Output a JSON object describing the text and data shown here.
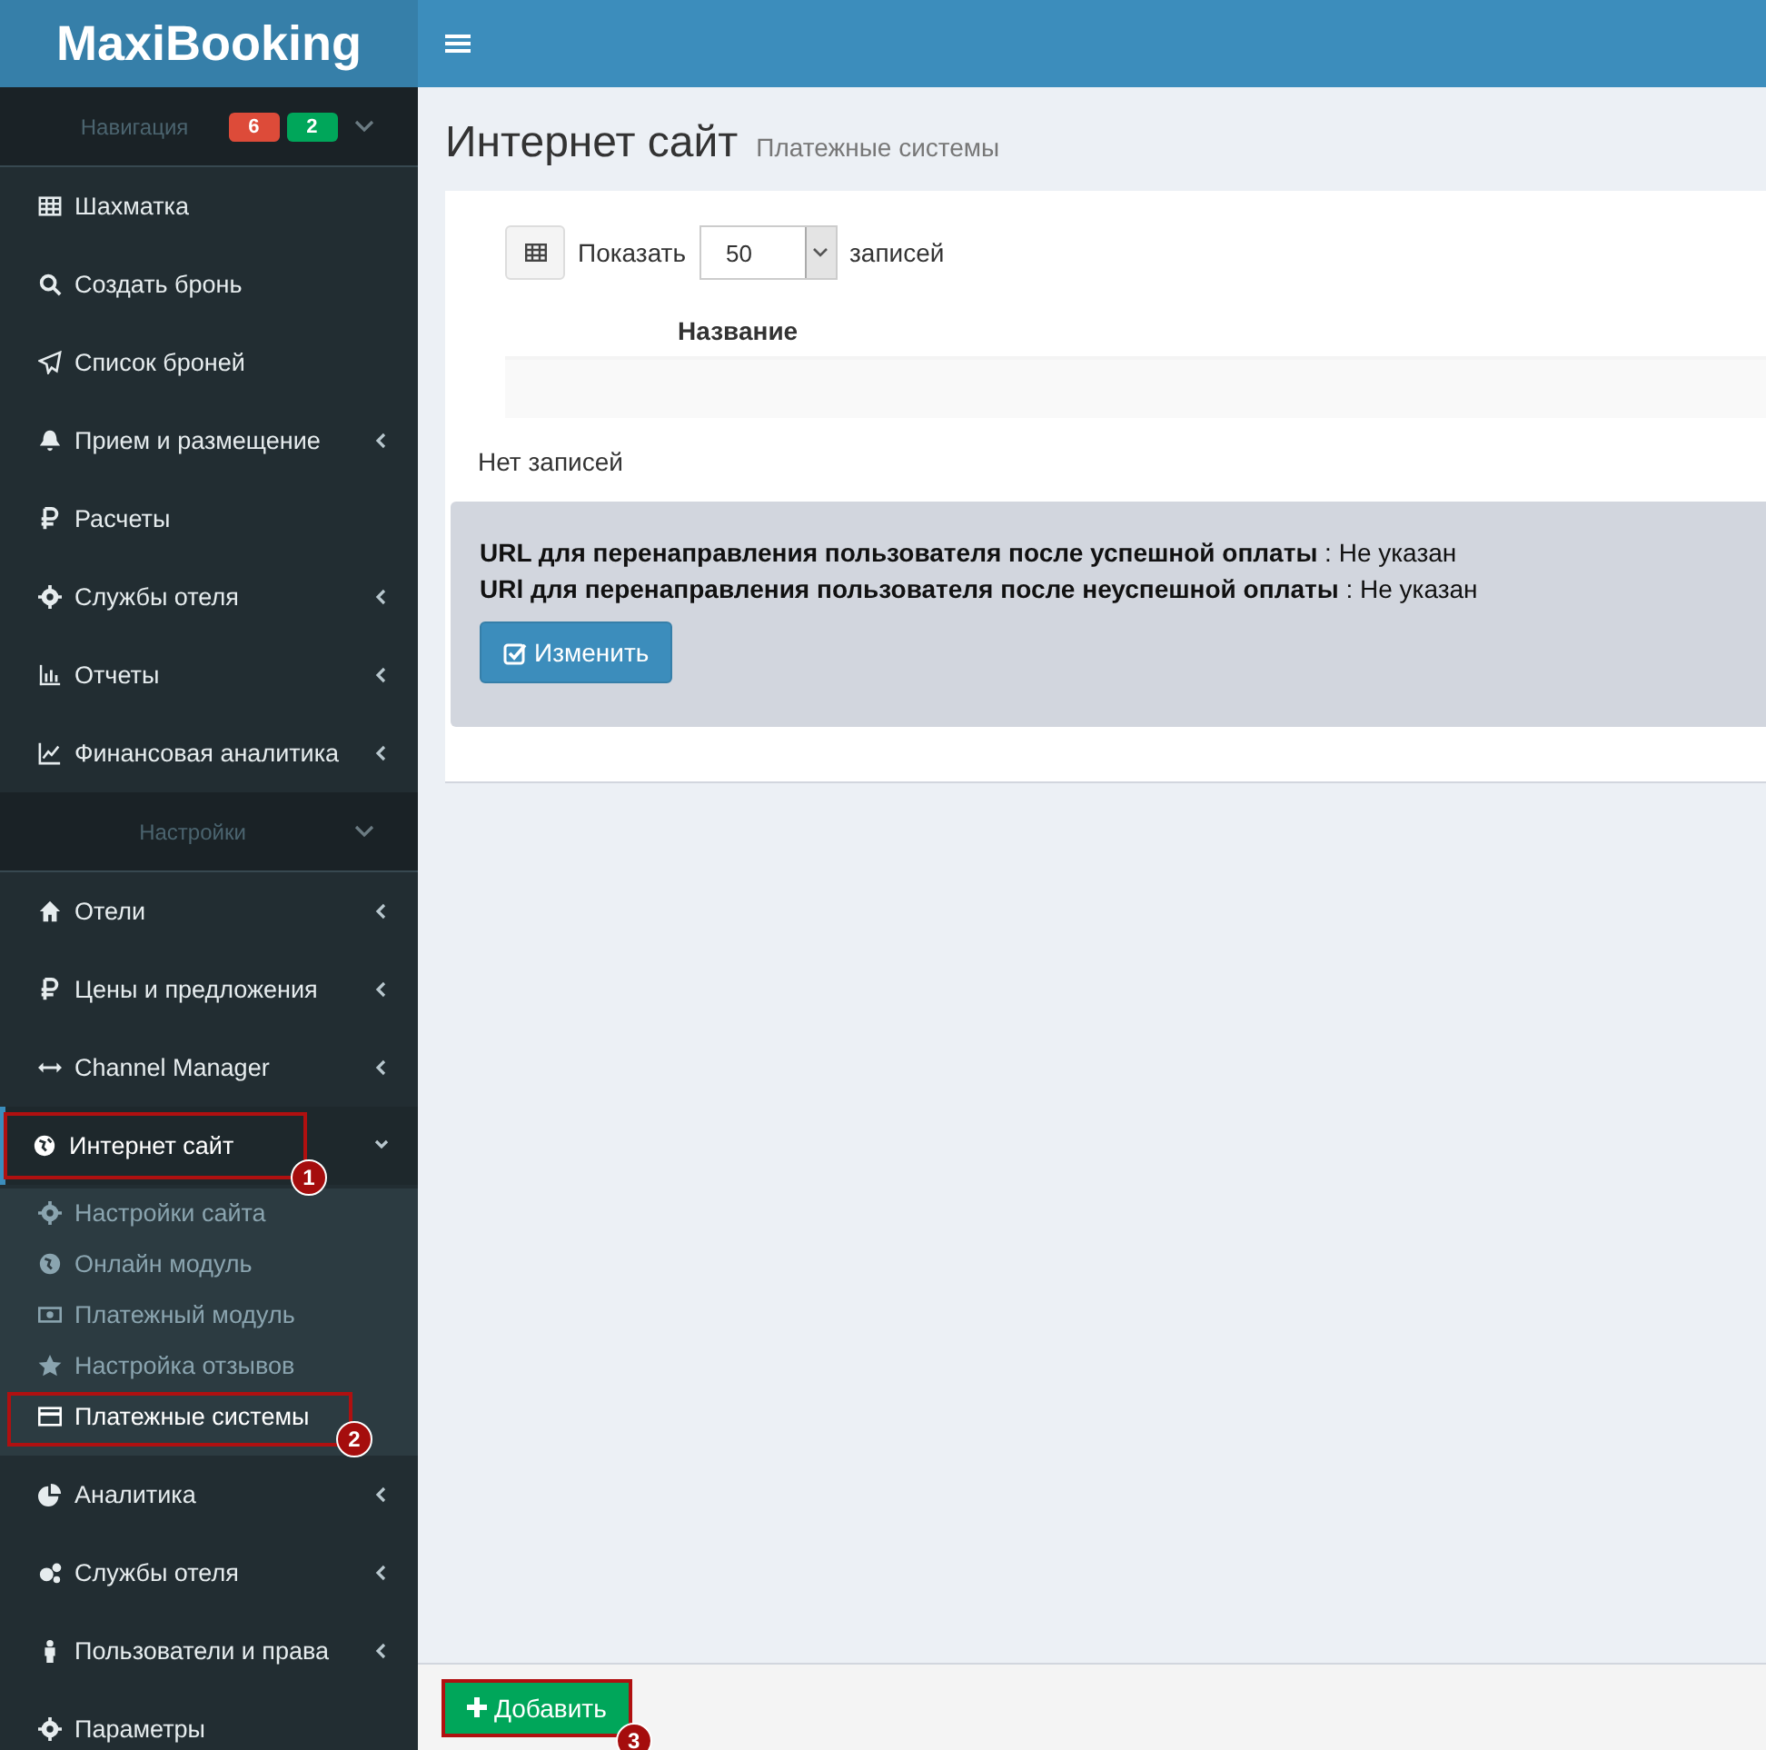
{
  "logo": "MaxiBooking",
  "sidebar": {
    "entries": [
      {
        "kind": "header",
        "label": "Навигация",
        "badges": [
          {
            "text": "6",
            "color": "#dd4b39"
          },
          {
            "text": "2",
            "color": "#00a65a"
          }
        ]
      },
      {
        "kind": "link",
        "label": "Шахматка"
      },
      {
        "kind": "link",
        "label": "Создать бронь"
      },
      {
        "kind": "link",
        "label": "Список броней"
      },
      {
        "kind": "menu",
        "label": "Прием и размещение",
        "expanded": false
      },
      {
        "kind": "link",
        "label": "Расчеты"
      },
      {
        "kind": "menu",
        "label": "Службы отеля",
        "expanded": false
      },
      {
        "kind": "menu",
        "label": "Отчеты",
        "expanded": false
      },
      {
        "kind": "menu",
        "label": "Финансовая аналитика",
        "expanded": false
      },
      {
        "kind": "header",
        "label": "Настройки"
      },
      {
        "kind": "menu",
        "label": "Отели",
        "expanded": false
      },
      {
        "kind": "menu",
        "label": "Цены и предложения",
        "expanded": false
      },
      {
        "kind": "menu",
        "label": "Channel Manager",
        "expanded": false
      },
      {
        "kind": "menu",
        "label": "Интернет сайт",
        "expanded": true,
        "callout": "1",
        "children": [
          {
            "label": "Настройки сайта",
            "selected": false
          },
          {
            "label": "Онлайн модуль",
            "selected": false
          },
          {
            "label": "Платежный модуль",
            "selected": false
          },
          {
            "label": "Настройка отзывов",
            "selected": false
          },
          {
            "label": "Платежные системы",
            "selected": true,
            "callout": "2"
          }
        ]
      },
      {
        "kind": "menu",
        "label": "Аналитика",
        "expanded": false
      },
      {
        "kind": "menu",
        "label": "Службы отеля",
        "expanded": false
      },
      {
        "kind": "menu",
        "label": "Пользователи и права",
        "expanded": false
      },
      {
        "kind": "link",
        "label": "Параметры"
      }
    ]
  },
  "page": {
    "title": "Интернет сайт",
    "subtitle": "Платежные системы"
  },
  "table": {
    "show_label": "Показать",
    "page_size": "50",
    "records_label": "записей",
    "columns": [
      "Название"
    ],
    "empty": "Нет записей"
  },
  "settings": {
    "lines": [
      "**URL для перенаправления пользователя после успешной оплаты** : Не указан",
      "**URl для перенаправления пользователя после неуспешной оплаты** : Не указан"
    ],
    "edit_button": "Изменить"
  },
  "footer": {
    "add_button": "Добавить",
    "callout": "3"
  }
}
